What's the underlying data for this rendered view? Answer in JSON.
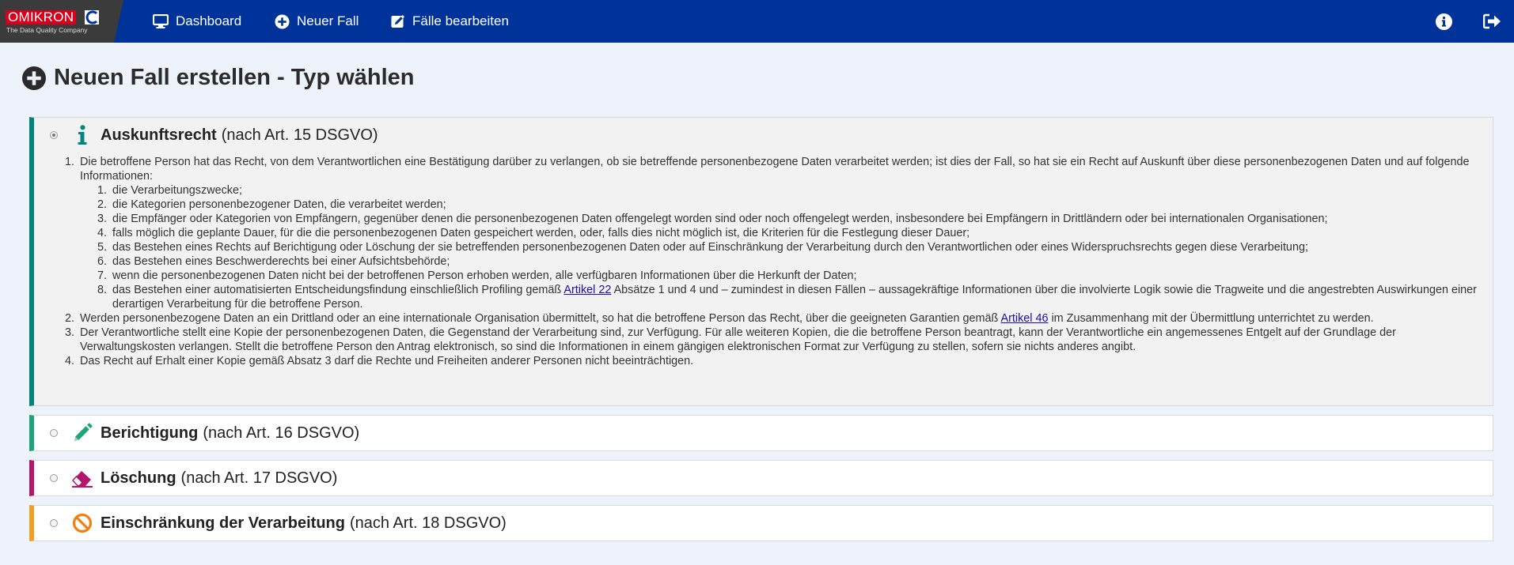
{
  "brand": {
    "name": "OMIKRON",
    "tagline": "The Data Quality Company",
    "colors": {
      "topbar": "#003399",
      "logo_red": "#d6001c"
    }
  },
  "nav": {
    "items": [
      {
        "label": "Dashboard",
        "icon": "monitor-icon"
      },
      {
        "label": "Neuer Fall",
        "icon": "plus-circle-icon"
      },
      {
        "label": "Fälle bearbeiten",
        "icon": "edit-icon"
      }
    ],
    "right_icons": [
      "info-icon",
      "logout-icon"
    ]
  },
  "page": {
    "title": "Neuen Fall erstellen - Typ wählen"
  },
  "cases": [
    {
      "title": "Auskunftsrecht",
      "ref": "(nach Art. 15 DSGVO)",
      "icon": "info-icon",
      "accent": "#00857f",
      "selected": true,
      "paragraphs": [
        {
          "text": "Die betroffene Person hat das Recht, von dem Verantwortlichen eine Bestätigung darüber zu verlangen, ob sie betreffende personenbezogene Daten verarbeitet werden; ist dies der Fall, so hat sie ein Recht auf Auskunft über diese personenbezogenen Daten und auf folgende Informationen:",
          "subitems": [
            "die Verarbeitungszwecke;",
            "die Kategorien personenbezogener Daten, die verarbeitet werden;",
            "die Empfänger oder Kategorien von Empfängern, gegenüber denen die personenbezogenen Daten offengelegt worden sind oder noch offengelegt werden, insbesondere bei Empfängern in Drittländern oder bei internationalen Organisationen;",
            "falls möglich die geplante Dauer, für die die personenbezogenen Daten gespeichert werden, oder, falls dies nicht möglich ist, die Kriterien für die Festlegung dieser Dauer;",
            "das Bestehen eines Rechts auf Berichtigung oder Löschung der sie betreffenden personenbezogenen Daten oder auf Einschränkung der Verarbeitung durch den Verantwortlichen oder eines Widerspruchsrechts gegen diese Verarbeitung;",
            "das Bestehen eines Beschwerderechts bei einer Aufsichtsbehörde;",
            "wenn die personenbezogenen Daten nicht bei der betroffenen Person erhoben werden, alle verfügbaren Informationen über die Herkunft der Daten;"
          ],
          "last_subitem": {
            "before": "das Bestehen einer automatisierten Entscheidungsfindung einschließlich Profiling gemäß ",
            "link": "Artikel 22",
            "after": " Absätze 1 und 4 und – zumindest in diesen Fällen – aussagekräftige Informationen über die involvierte Logik sowie die Tragweite und die angestrebten Auswirkungen einer derartigen Verarbeitung für die betroffene Person."
          }
        },
        {
          "before": "Werden personenbezogene Daten an ein Drittland oder an eine internationale Organisation übermittelt, so hat die betroffene Person das Recht, über die geeigneten Garantien gemäß ",
          "link": "Artikel 46",
          "after": " im Zusammenhang mit der Übermittlung unterrichtet zu werden."
        },
        {
          "text": "Der Verantwortliche stellt eine Kopie der personenbezogenen Daten, die Gegenstand der Verarbeitung sind, zur Verfügung. Für alle weiteren Kopien, die die betroffene Person beantragt, kann der Verantwortliche ein angemessenes Entgelt auf der Grundlage der Verwaltungskosten verlangen. Stellt die betroffene Person den Antrag elektronisch, so sind die Informationen in einem gängigen elektronischen Format zur Verfügung zu stellen, sofern sie nichts anderes angibt."
        },
        {
          "text": "Das Recht auf Erhalt einer Kopie gemäß Absatz 3 darf die Rechte und Freiheiten anderer Personen nicht beeinträchtigen."
        }
      ]
    },
    {
      "title": "Berichtigung",
      "ref": "(nach Art. 16 DSGVO)",
      "icon": "pencil-icon",
      "accent": "#1fa37a",
      "selected": false
    },
    {
      "title": "Löschung",
      "ref": "(nach Art. 17 DSGVO)",
      "icon": "eraser-icon",
      "accent": "#b5166b",
      "selected": false
    },
    {
      "title": "Einschränkung der Verarbeitung",
      "ref": "(nach Art. 18 DSGVO)",
      "icon": "ban-icon",
      "accent": "#f0a020",
      "selected": false
    }
  ]
}
